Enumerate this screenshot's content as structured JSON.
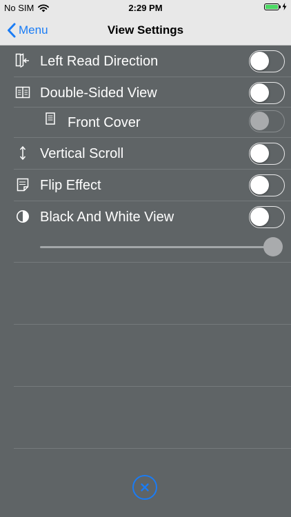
{
  "status_bar": {
    "carrier": "No SIM",
    "time": "2:29 PM",
    "battery_level": 1.0
  },
  "nav": {
    "back_label": "Menu",
    "title": "View Settings"
  },
  "settings": [
    {
      "label": "Left Read Direction",
      "icon": "left-read-direction-icon",
      "on": false
    },
    {
      "label": "Double-Sided View",
      "icon": "book-open-icon",
      "on": false
    },
    {
      "label": "Front Cover",
      "icon": "page-icon",
      "on": false,
      "enabled": false
    },
    {
      "label": "Vertical Scroll",
      "icon": "vertical-arrows-icon",
      "on": false
    },
    {
      "label": "Flip Effect",
      "icon": "page-curl-icon",
      "on": false
    },
    {
      "label": "Black And White View",
      "icon": "contrast-icon",
      "on": false
    }
  ],
  "bw_slider": {
    "value": 1.0
  },
  "colors": {
    "accent": "#1a7cf5",
    "background": "#5f6466",
    "bar": "#e8e8e8"
  },
  "close_button": {
    "icon": "close-icon"
  }
}
